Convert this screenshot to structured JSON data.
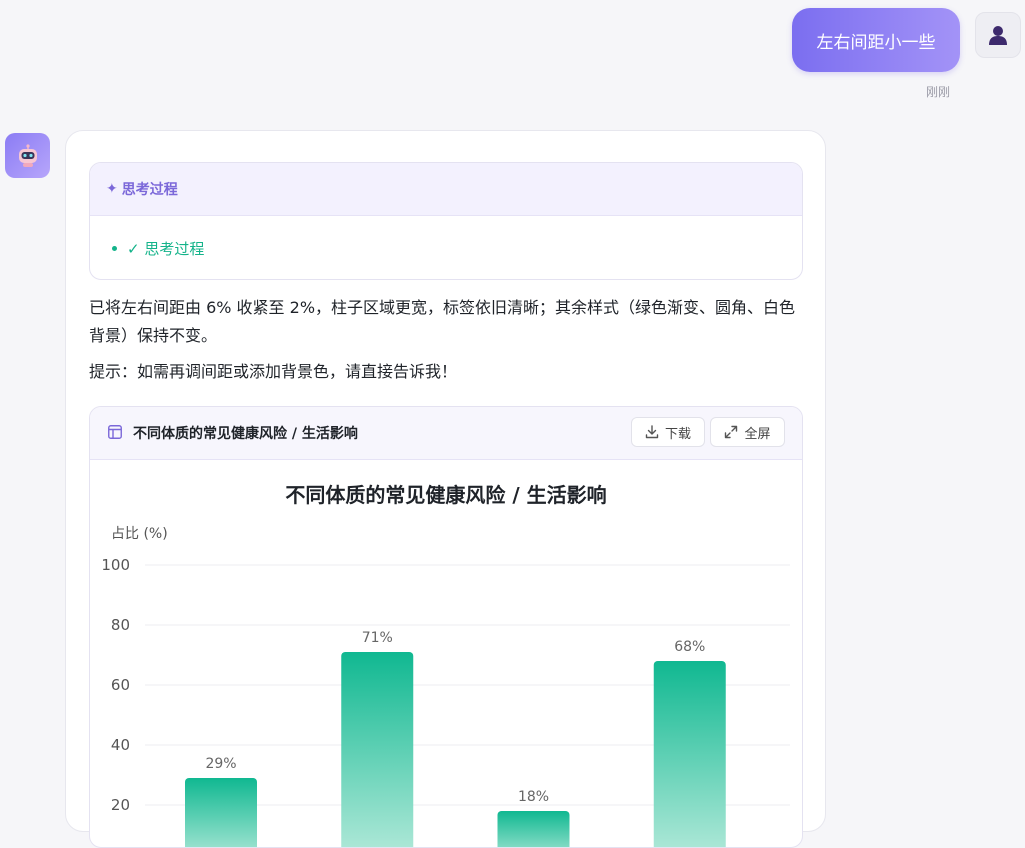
{
  "user_message": {
    "text": "左右间距小一些",
    "time": "刚刚",
    "avatar_icon": "user-icon"
  },
  "bot": {
    "avatar_icon": "robot-icon",
    "thinking": {
      "header_icon": "sparkle-icon",
      "header_label": "思考过程",
      "item_label": "✓ 思考过程"
    },
    "answer_paragraph": "已将左右间距由 6% 收紧至 2%，柱子区域更宽，标签依旧清晰；其余样式（绿色渐变、圆角、白色背景）保持不变。",
    "hint": "提示：如需再调间距或添加背景色，请直接告诉我！",
    "chart_card": {
      "title_icon": "layout-icon",
      "title": "不同体质的常见健康风险 / 生活影响",
      "download_label": "下载",
      "download_icon": "download-icon",
      "fullscreen_label": "全屏",
      "fullscreen_icon": "expand-icon"
    }
  },
  "colors": {
    "accent": "#7b6ef0",
    "success": "#14b38a",
    "bar_top": "#10b891",
    "bar_bottom": "#b8ebdc"
  },
  "chart_data": {
    "type": "bar",
    "title": "不同体质的常见健康风险 / 生活影响",
    "ylabel": "占比 (%)",
    "ylim": [
      0,
      100
    ],
    "yticks": [
      20,
      40,
      60,
      80,
      100
    ],
    "values": [
      29,
      71,
      18,
      68
    ],
    "value_labels": [
      "29%",
      "71%",
      "18%",
      "68%"
    ],
    "grid": true
  }
}
